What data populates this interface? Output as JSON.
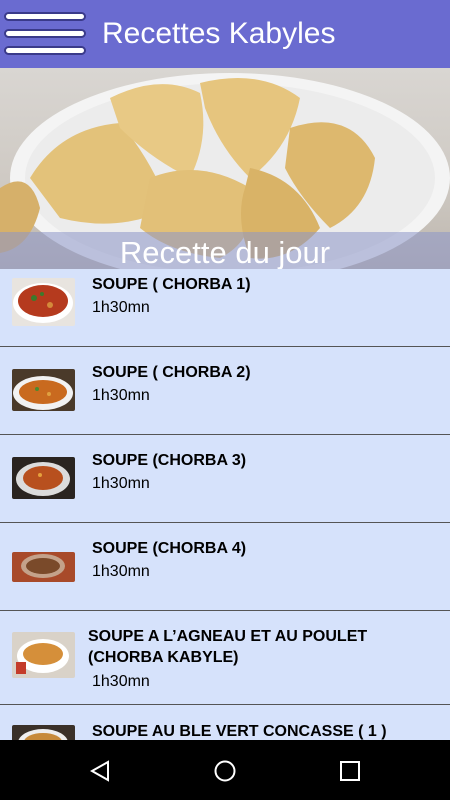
{
  "app": {
    "title": "Recettes Kabyles"
  },
  "hero": {
    "caption": "Recette du jour"
  },
  "recipes": [
    {
      "title": "SOUPE ( CHORBA 1)",
      "duration": "1h30mn"
    },
    {
      "title": "SOUPE ( CHORBA 2)",
      "duration": "1h30mn"
    },
    {
      "title": "SOUPE (CHORBA 3)",
      "duration": "1h30mn"
    },
    {
      "title": "SOUPE (CHORBA 4)",
      "duration": "1h30mn"
    },
    {
      "title": "SOUPE A L’AGNEAU ET AU POULET (CHORBA KABYLE)",
      "duration": "1h30mn"
    },
    {
      "title": "SOUPE  AU BLE VERT CONCASSE ( 1 )",
      "duration": ""
    }
  ],
  "nav": {
    "back": "back-icon",
    "home": "home-icon",
    "recents": "recents-icon"
  },
  "colors": {
    "appbar": "#6a6bd0",
    "list_bg": "#d6e2fb"
  }
}
